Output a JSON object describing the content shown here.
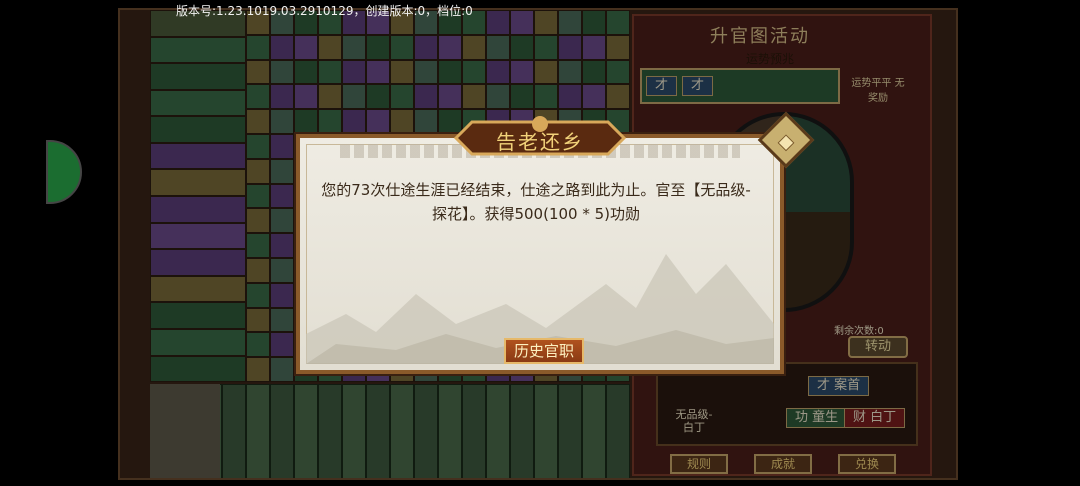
{
  "status_bar": {
    "version_text": "版本号:1.23.1019.03.2910129，创建版本:0，档位:0"
  },
  "board": {
    "panel_title": "升官图活动",
    "fortune_label": "运势预兆",
    "fortune_chips": [
      "才",
      "才"
    ],
    "side_note": "运势平平 无奖励",
    "remaining_label": "剩余次数:0",
    "turn_button": "转动",
    "player_name": "无品级-白丁",
    "stats": [
      {
        "label": "才",
        "value": "案首"
      },
      {
        "label": "功",
        "value": "童生"
      },
      {
        "label": "财",
        "value": "白丁"
      }
    ],
    "bottom_buttons": [
      "规则",
      "成就",
      "兑换"
    ]
  },
  "dialog": {
    "title": "告老还乡",
    "message": "您的73次仕途生涯已经结束，仕途之路到此为止。官至【无品级-探花】。获得500(100 * 5)功勋",
    "history_button": "历史官职"
  },
  "colors": {
    "dialog_border": "#8a5a2a",
    "button_bg": "#9a4418",
    "title_gold": "#f2d27a"
  }
}
